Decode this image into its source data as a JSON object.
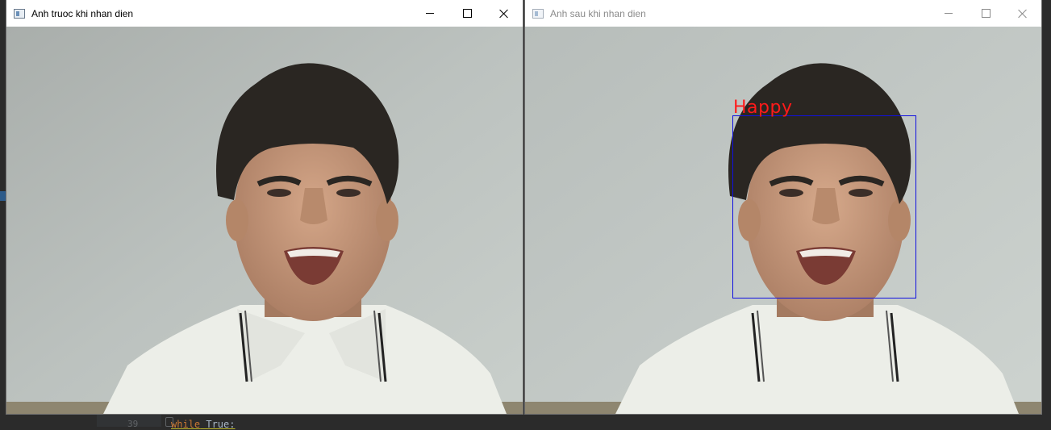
{
  "window_left": {
    "title": "Anh truoc khi nhan dien",
    "controls": {
      "minimize": "minimize",
      "maximize": "maximize",
      "close": "close"
    }
  },
  "window_right": {
    "title": "Anh sau khi nhan dien",
    "detection": {
      "label": "Happy",
      "box_color": "#1010e0",
      "label_color": "#ff1a1a"
    }
  },
  "editor": {
    "line_number": "39",
    "code_keyword": "while",
    "code_rest": " True:"
  },
  "colors": {
    "wall": "#b9bfbc",
    "shirt": "#eceee8",
    "hair": "#2a2622",
    "skin": "#c99a7e"
  }
}
